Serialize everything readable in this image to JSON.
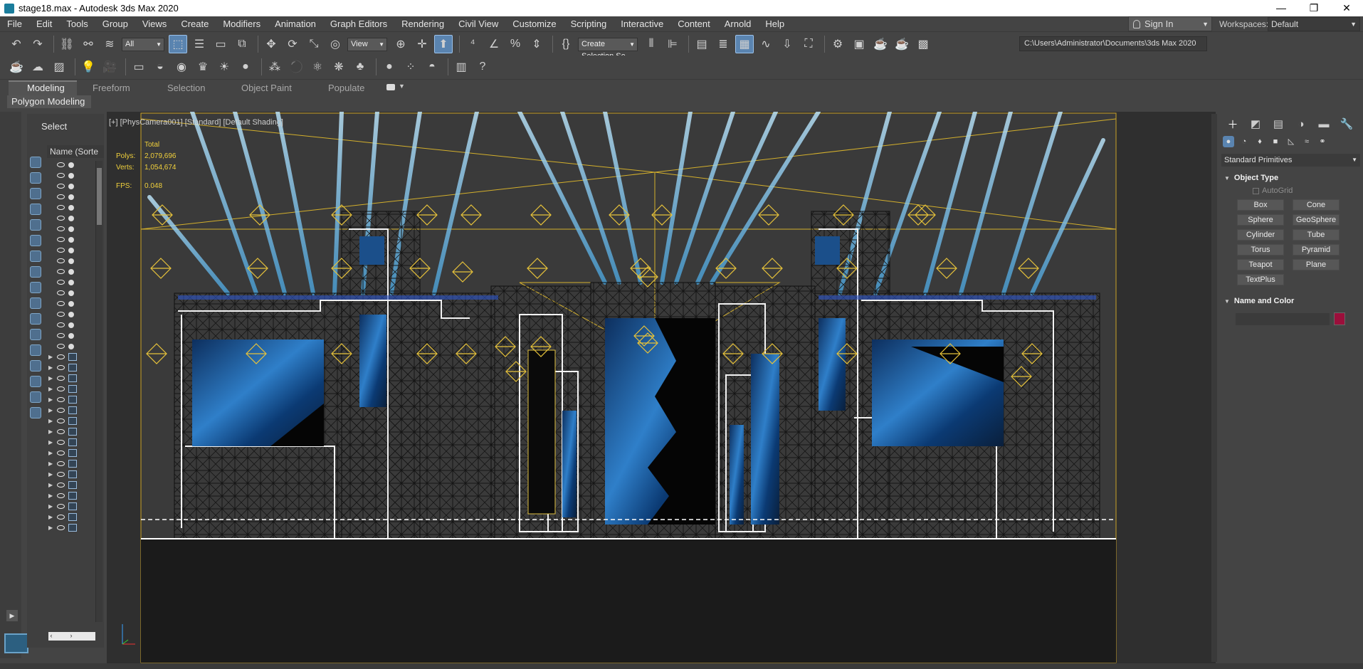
{
  "titlebar": {
    "title": "stage18.max - Autodesk 3ds Max 2020",
    "minimize": "—",
    "restore": "❐",
    "close": "✕"
  },
  "menu": [
    "File",
    "Edit",
    "Tools",
    "Group",
    "Views",
    "Create",
    "Modifiers",
    "Animation",
    "Graph Editors",
    "Rendering",
    "Civil View",
    "Customize",
    "Scripting",
    "Interactive",
    "Content",
    "Arnold",
    "Help"
  ],
  "signin": {
    "label": "Sign In"
  },
  "workspaces": {
    "label": "Workspaces:",
    "value": "Default"
  },
  "toolbar": {
    "filter": "All",
    "ref_coord": "View",
    "selection_set": "Create Selection Se",
    "path": "C:\\Users\\Administrator\\Documents\\3ds Max 2020"
  },
  "ribbon": {
    "tabs": [
      "Modeling",
      "Freeform",
      "Selection",
      "Object Paint",
      "Populate"
    ],
    "active": "Modeling",
    "panel": "Polygon Modeling"
  },
  "scene_explorer": {
    "title": "Select",
    "column": "Name (Sorte"
  },
  "viewport": {
    "label": "[+] [PhysCamera001] [Standard] [Default Shading]",
    "stats": {
      "total_label": "Total",
      "polys_label": "Polys:",
      "polys": "2,079,696",
      "verts_label": "Verts:",
      "verts": "1,054,674",
      "fps_label": "FPS:",
      "fps": "0.048"
    }
  },
  "command_panel": {
    "dropdown": "Standard Primitives",
    "object_type_title": "Object Type",
    "autogrid": "AutoGrid",
    "buttons": [
      "Box",
      "Cone",
      "Sphere",
      "GeoSphere",
      "Cylinder",
      "Tube",
      "Torus",
      "Pyramid",
      "Teapot",
      "Plane",
      "TextPlus"
    ],
    "name_color_title": "Name and Color",
    "color": "#9b0f3b"
  }
}
